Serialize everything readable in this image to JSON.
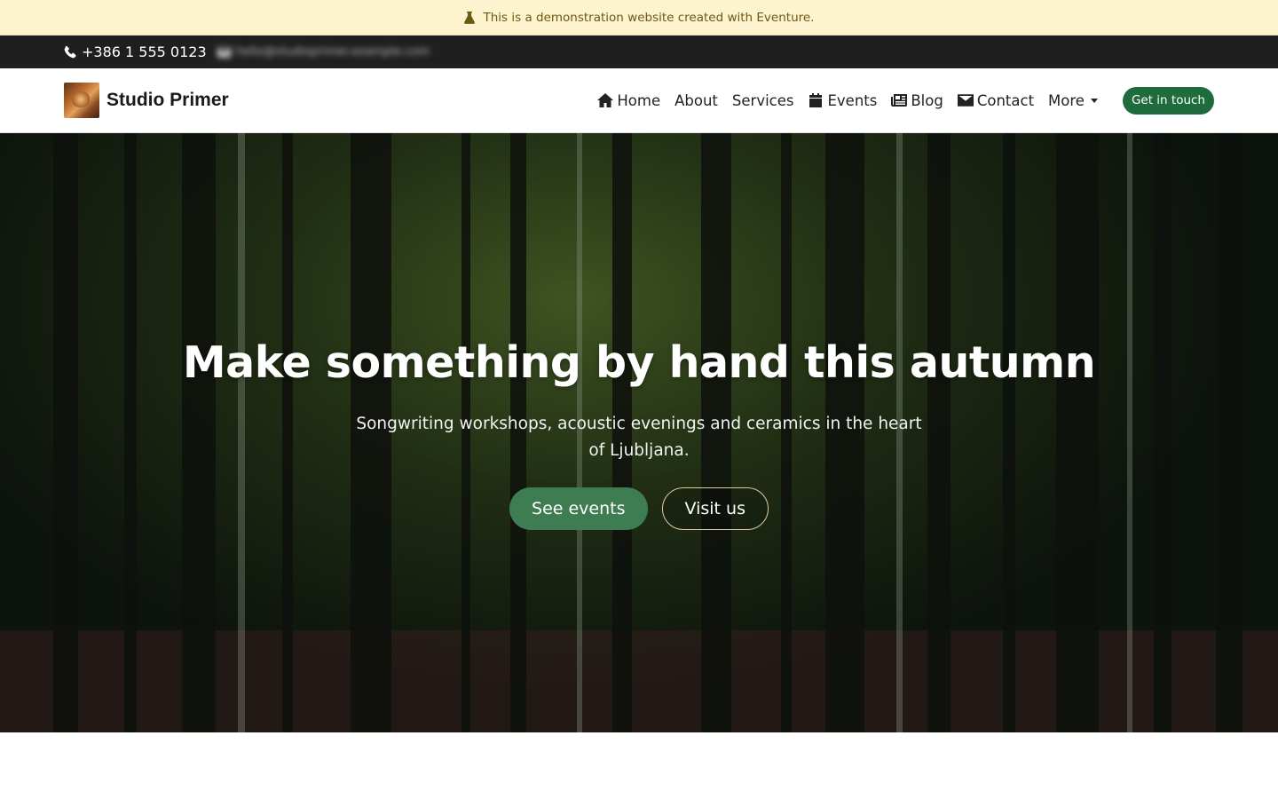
{
  "banner": {
    "text": "This is a demonstration website created with Eventure.",
    "icon": "flask-icon"
  },
  "topbar": {
    "phone": "+386 1 555 0123",
    "email": "hello@studioprimer.example.com"
  },
  "navbar": {
    "brand": "Studio Primer",
    "items": [
      {
        "label": "Home",
        "icon": "home-icon"
      },
      {
        "label": "About"
      },
      {
        "label": "Services"
      },
      {
        "label": "Events",
        "icon": "calendar-icon"
      },
      {
        "label": "Blog",
        "icon": "newspaper-icon"
      },
      {
        "label": "Contact",
        "icon": "envelope-icon"
      },
      {
        "label": "More",
        "icon": "caret-down-icon"
      }
    ],
    "cta": "Get in touch"
  },
  "hero": {
    "title": "Make something by hand this autumn",
    "subtitle": "Songwriting workshops, acoustic evenings and ceramics in the heart of Ljubljana.",
    "primary_button": "See events",
    "secondary_button": "Visit us"
  },
  "colors": {
    "banner_bg": "#fdf3cf",
    "topbar_bg": "#1f1f1f",
    "cta_green": "#1e6b3c",
    "hero_button_green": "#3e7d52",
    "outline_border": "#e3c9a0"
  }
}
